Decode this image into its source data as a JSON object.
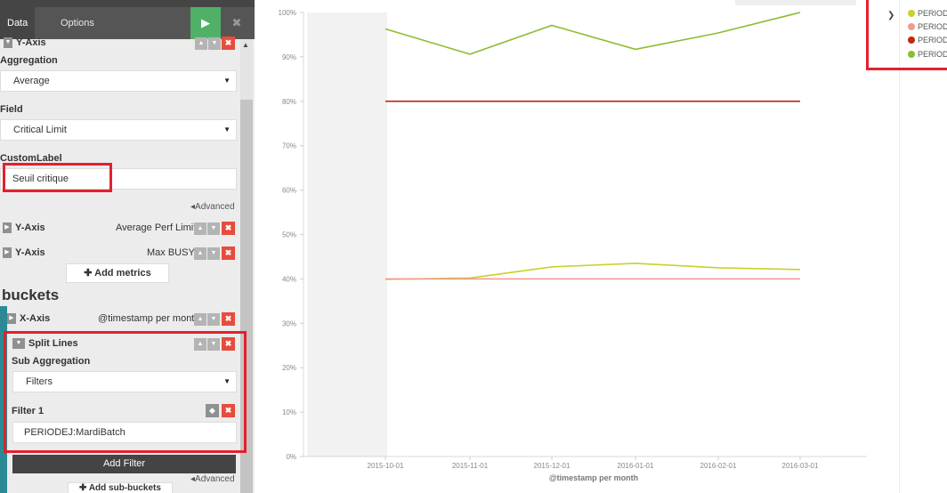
{
  "editor": {
    "tabs": [
      {
        "label": "Data"
      },
      {
        "label": "Options"
      }
    ],
    "run_icon": "play-icon",
    "discard_icon": "close-icon",
    "metric_yaxis": {
      "title": "Y-Axis",
      "aggregation_label": "Aggregation",
      "aggregation_value": "Average",
      "field_label": "Field",
      "field_value": "Critical Limit",
      "customlabel_label": "CustomLabel",
      "customlabel_value": "Seuil critique",
      "advanced_label": "Advanced"
    },
    "collapsed_metrics": [
      {
        "title": "Y-Axis",
        "summary": "Average Perf Limit"
      },
      {
        "title": "Y-Axis",
        "summary": "Max BUSY"
      }
    ],
    "add_metrics_label": "Add metrics",
    "buckets": {
      "title": "buckets",
      "xaxis": {
        "title": "X-Axis",
        "summary": "@timestamp per month"
      },
      "split": {
        "title": "Split Lines",
        "sub_agg_label": "Sub Aggregation",
        "sub_agg_value": "Filters",
        "filter_label": "Filter 1",
        "filter_value": "PERIODEJ:MardiBatch",
        "add_filter_label": "Add Filter",
        "advanced_label": "Advanced"
      },
      "add_subbuckets_label": "Add sub-buckets"
    }
  },
  "legend": {
    "toggle_icon": "chevron-right-icon",
    "items": [
      {
        "label": "PERIODE",
        "color": "#c7d22a"
      },
      {
        "label": "PERIODE",
        "color": "#f19a93"
      },
      {
        "label": "PERIODE",
        "color": "#c0290f"
      },
      {
        "label": "PERIODE",
        "color": "#8cbd32"
      }
    ]
  },
  "chart_data": {
    "type": "line",
    "xlabel": "@timestamp per month",
    "ylabel": "",
    "x": [
      "2015-10-01",
      "2015-11-01",
      "2015-12-01",
      "2016-01-01",
      "2016-02-01",
      "2016-03-01"
    ],
    "yticks": [
      "0%",
      "10%",
      "20%",
      "30%",
      "40%",
      "50%",
      "60%",
      "70%",
      "80%",
      "90%",
      "100%"
    ],
    "ylim": [
      0,
      100
    ],
    "series": [
      {
        "name": "PERIODE",
        "color": "#8cbd32",
        "values": [
          96.3,
          90.6,
          97.1,
          91.7,
          95.4,
          100
        ]
      },
      {
        "name": "PERIODE",
        "color": "#c0290f",
        "values": [
          80,
          80,
          80,
          80,
          80,
          80
        ]
      },
      {
        "name": "PERIODE",
        "color": "#c7d22a",
        "values": [
          39.9,
          40.2,
          42.7,
          43.5,
          42.5,
          42.1
        ]
      },
      {
        "name": "PERIODE",
        "color": "#f19a93",
        "values": [
          40,
          40,
          40,
          40,
          40,
          40
        ]
      }
    ],
    "grid": false,
    "legend": "right"
  }
}
